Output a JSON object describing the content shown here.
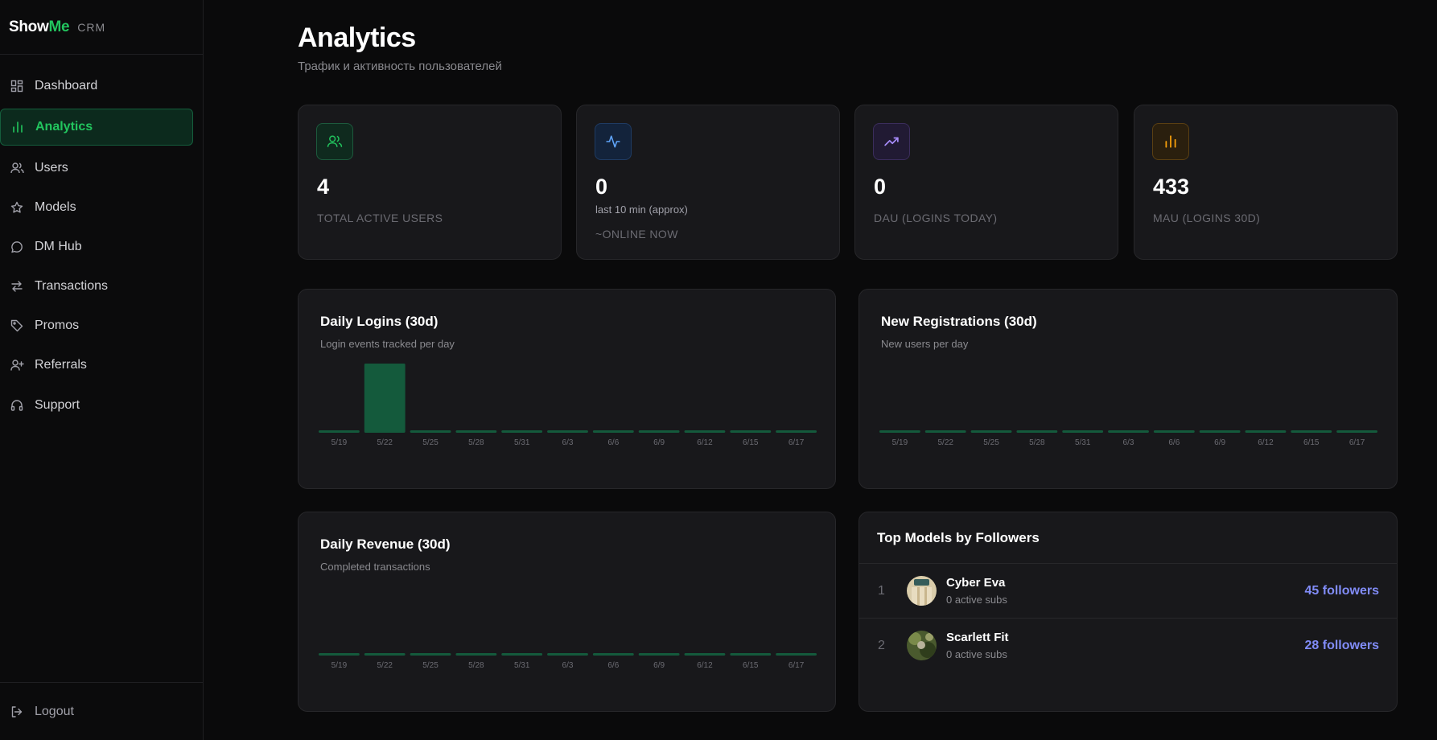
{
  "brand": {
    "show": "Show",
    "me": "Me",
    "crm": "CRM"
  },
  "sidebar": {
    "items": [
      {
        "label": "Dashboard",
        "icon": "dashboard-icon"
      },
      {
        "label": "Analytics",
        "icon": "bar-chart-icon",
        "active": true
      },
      {
        "label": "Users",
        "icon": "users-icon"
      },
      {
        "label": "Models",
        "icon": "star-icon"
      },
      {
        "label": "DM Hub",
        "icon": "message-icon"
      },
      {
        "label": "Transactions",
        "icon": "arrows-swap-icon"
      },
      {
        "label": "Promos",
        "icon": "tag-icon"
      },
      {
        "label": "Referrals",
        "icon": "user-plus-icon"
      },
      {
        "label": "Support",
        "icon": "headphones-icon"
      }
    ],
    "logout": "Logout"
  },
  "header": {
    "title": "Analytics",
    "subtitle": "Трафик и активность пользователей"
  },
  "stats": [
    {
      "value": "4",
      "label": "TOTAL ACTIVE USERS",
      "note": "",
      "icon": "users-icon",
      "color": "#22c55e"
    },
    {
      "value": "0",
      "label": "~ONLINE NOW",
      "note": "last 10 min (approx)",
      "icon": "activity-icon",
      "color": "#60a5fa"
    },
    {
      "value": "0",
      "label": "DAU (LOGINS TODAY)",
      "note": "",
      "icon": "trending-up-icon",
      "color": "#a78bfa"
    },
    {
      "value": "433",
      "label": "MAU (LOGINS 30D)",
      "note": "",
      "icon": "bar-chart-icon",
      "color": "#f59e0b"
    }
  ],
  "colors": {
    "accent": "#22c55e",
    "bar": "#145a3c",
    "followers": "#818cf8"
  },
  "charts": {
    "logins": {
      "title": "Daily Logins (30d)",
      "subtitle": "Login events tracked per day"
    },
    "registrations": {
      "title": "New Registrations (30d)",
      "subtitle": "New users per day"
    },
    "revenue": {
      "title": "Daily Revenue (30d)",
      "subtitle": "Completed transactions"
    }
  },
  "chart_data": [
    {
      "type": "bar",
      "title": "Daily Logins (30d)",
      "categories": [
        "5/19",
        "5/22",
        "5/25",
        "5/28",
        "5/31",
        "6/3",
        "6/6",
        "6/9",
        "6/12",
        "6/15",
        "6/17"
      ],
      "values": [
        0,
        433,
        0,
        0,
        0,
        0,
        0,
        0,
        0,
        0,
        0
      ],
      "grid": false
    },
    {
      "type": "bar",
      "title": "New Registrations (30d)",
      "categories": [
        "5/19",
        "5/22",
        "5/25",
        "5/28",
        "5/31",
        "6/3",
        "6/6",
        "6/9",
        "6/12",
        "6/15",
        "6/17"
      ],
      "values": [
        0,
        0,
        0,
        0,
        0,
        0,
        0,
        0,
        0,
        0,
        0
      ],
      "grid": false
    },
    {
      "type": "bar",
      "title": "Daily Revenue (30d)",
      "categories": [
        "5/19",
        "5/22",
        "5/25",
        "5/28",
        "5/31",
        "6/3",
        "6/6",
        "6/9",
        "6/12",
        "6/15",
        "6/17"
      ],
      "values": [
        0,
        0,
        0,
        0,
        0,
        0,
        0,
        0,
        0,
        0,
        0
      ],
      "grid": false
    }
  ],
  "top_models": {
    "title": "Top Models by Followers",
    "items": [
      {
        "rank": "1",
        "name": "Cyber Eva",
        "subs": "0 active subs",
        "followers": "45 followers"
      },
      {
        "rank": "2",
        "name": "Scarlett Fit",
        "subs": "0 active subs",
        "followers": "28 followers"
      }
    ]
  }
}
